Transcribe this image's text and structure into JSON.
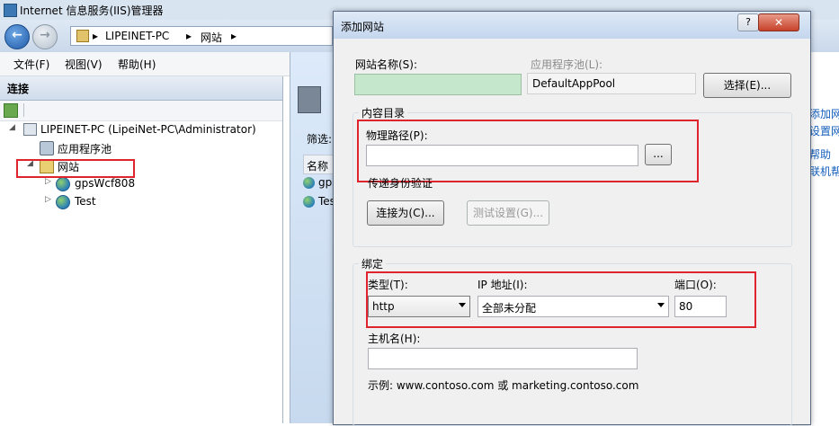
{
  "window": {
    "title": "Internet 信息服务(IIS)管理器"
  },
  "address": {
    "crumbs": [
      "LIPEINET-PC",
      "▸",
      "网站",
      "▸"
    ]
  },
  "menu": {
    "items": [
      "文件(F)",
      "视图(V)",
      "帮助(H)"
    ]
  },
  "connections": {
    "header": "连接",
    "tree": [
      {
        "label": "LIPEINET-PC (LipeiNet-PC\\Administrator)",
        "expander": "◢",
        "icon": "server-icon"
      },
      {
        "label": "应用程序池",
        "expander": "",
        "icon": "app-pool-icon"
      },
      {
        "label": "网站",
        "expander": "◢",
        "icon": "sites-folder-icon"
      },
      {
        "label": "gpsWcf808",
        "expander": "▷",
        "icon": "globe-icon"
      },
      {
        "label": "Test",
        "expander": "▷",
        "icon": "globe-icon"
      }
    ]
  },
  "middle": {
    "filter_label": "筛选:",
    "column_header": "名称",
    "rows": [
      "gps",
      "Tes"
    ]
  },
  "actions": {
    "items": [
      "添加网站",
      "设置网站",
      "帮助",
      "联机帮助"
    ]
  },
  "dialog": {
    "title": "添加网站",
    "help_label": "?",
    "close_label": "✕",
    "site_name_label": "网站名称(S):",
    "site_name_value": "",
    "app_pool_label": "应用程序池(L):",
    "app_pool_value": "DefaultAppPool",
    "select_button": "选择(E)...",
    "content_dir_group": "内容目录",
    "physical_path_label": "物理路径(P):",
    "physical_path_value": "",
    "browse_button": "...",
    "pass_through_auth": "传递身份验证",
    "connect_as_button": "连接为(C)...",
    "test_settings_button": "测试设置(G)...",
    "binding_group": "绑定",
    "type_label": "类型(T):",
    "type_value": "http",
    "ip_label": "IP 地址(I):",
    "ip_value": "全部未分配",
    "port_label": "端口(O):",
    "port_value": "80",
    "host_name_label": "主机名(H):",
    "host_name_value": "",
    "example_text": "示例: www.contoso.com 或 marketing.contoso.com"
  },
  "colors": {
    "highlight_box": "#e0242d",
    "site_name_fill": "#c5e8cc"
  }
}
